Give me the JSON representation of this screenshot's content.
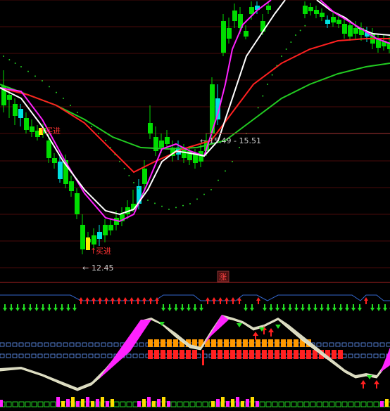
{
  "main_chart": {
    "annotations": {
      "buy_signal_1": "买进",
      "buy_signal_2": "买进",
      "low_price_label": "12.45",
      "range_label": "15.49 - 15.51",
      "up_tag": "涨"
    }
  },
  "colors": {
    "background": "#000000",
    "grid": "#4a0a0a",
    "up_candle": "#ff2a2a",
    "down_candle": "#00dd00",
    "flat_candle": "#00e0e0",
    "ma_white": "#ffffff",
    "ma_red": "#ff2020",
    "ma_green": "#22cc22",
    "ma_magenta": "#ff22ff",
    "dots": "#22cc22",
    "arrow_up": "#ff2020",
    "arrow_down": "#22dd22",
    "bar_orange": "#ff9900",
    "bar_red": "#ff2020",
    "divider": "#3355aa"
  }
}
